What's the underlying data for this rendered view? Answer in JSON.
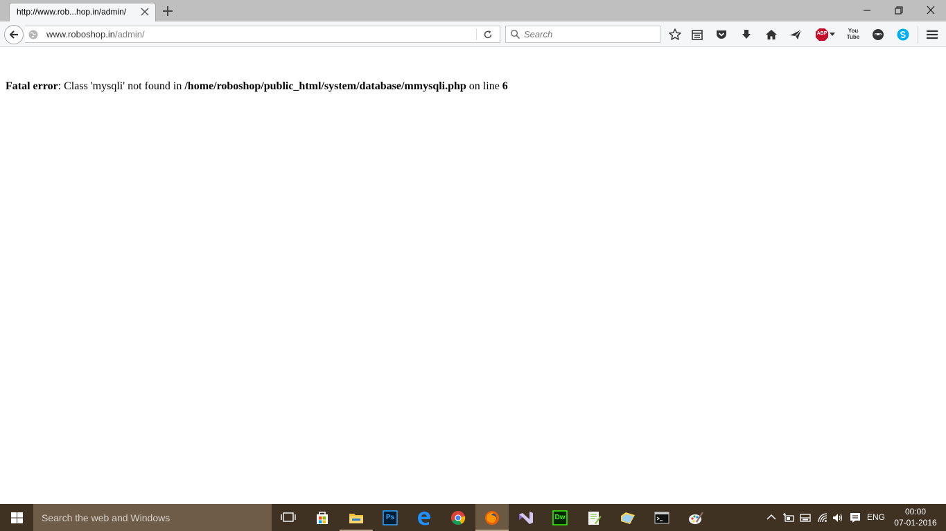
{
  "browser": {
    "tab": {
      "title": "http://www.rob...hop.in/admin/"
    },
    "url": {
      "host": "www.roboshop.in",
      "path": "/admin/"
    },
    "search": {
      "placeholder": "Search"
    },
    "toolbar_icons": [
      "bookmark-star-icon",
      "reading-list-icon",
      "pocket-icon",
      "download-icon",
      "home-icon",
      "send-icon",
      "adblock-plus-icon",
      "youtube-icon",
      "chat-icon",
      "skype-icon",
      "menu-icon"
    ],
    "adblock_label": "ABP",
    "youtube_label": "You Tube"
  },
  "page": {
    "error_label": "Fatal error",
    "message_part1": ": Class 'mysqli' not found in ",
    "path": "/home/roboshop/public_html/system/database/mmysqli.php",
    "message_part2": " on line ",
    "line": "6"
  },
  "taskbar": {
    "search_placeholder": "Search the web and Windows",
    "apps": [
      "task-view",
      "store",
      "photoshop",
      "edge",
      "chrome",
      "firefox",
      "visual-studio",
      "dreamweaver",
      "notepad-plus-plus",
      "file-explorer-alt",
      "command-prompt",
      "paint"
    ],
    "photoshop_label": "Ps",
    "dreamweaver_label": "Dw",
    "language": "ENG",
    "time": "00:00",
    "date": "07-01-2016"
  },
  "colors": {
    "taskbar_bg": "#3f3223",
    "taskbar_search_bg": "#6e5c49",
    "tabstrip_bg": "#bfbfbf",
    "navbar_bg": "#f5f6f7"
  }
}
